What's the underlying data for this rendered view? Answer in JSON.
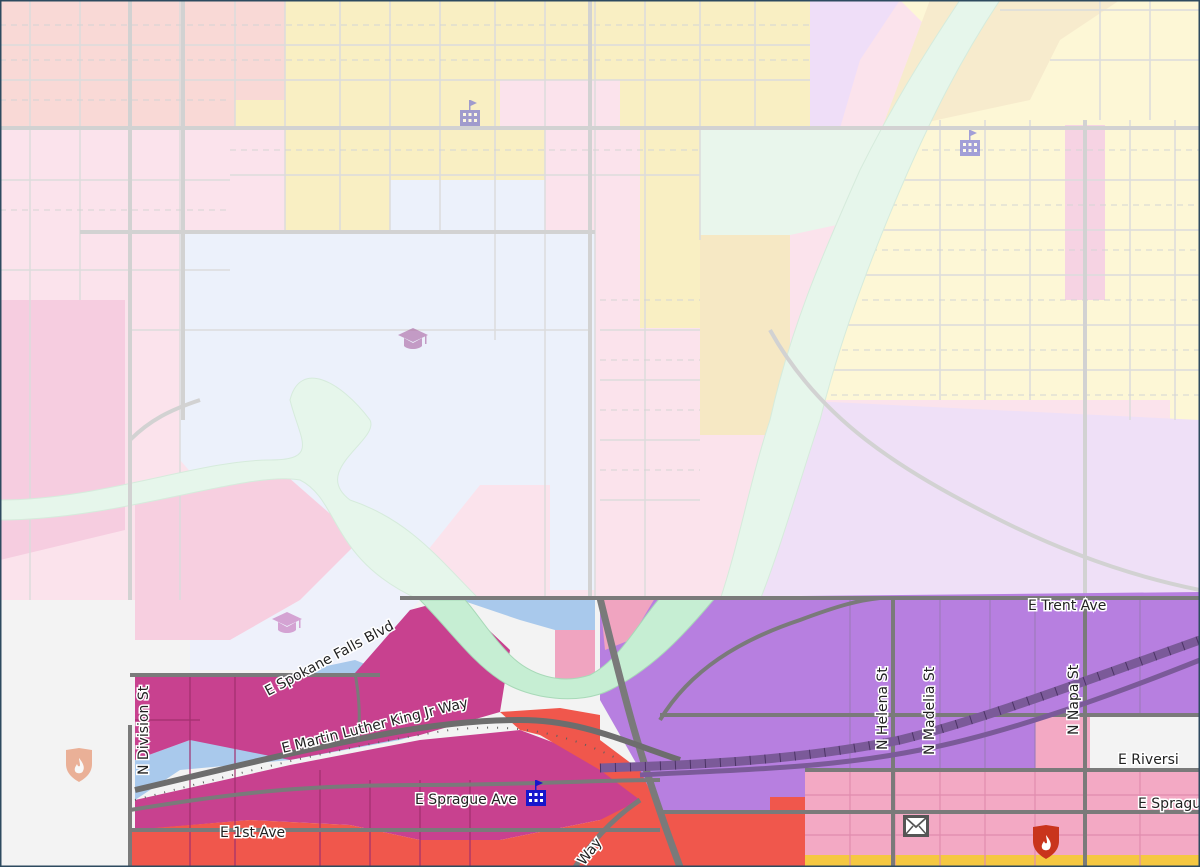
{
  "map": {
    "streets": [
      {
        "id": "e-trent-ave",
        "label": "E Trent Ave"
      },
      {
        "id": "e-spokane-falls-blvd",
        "label": "E Spokane Falls Blvd"
      },
      {
        "id": "e-mlk-jr-way",
        "label": "E Martin Luther King Jr Way"
      },
      {
        "id": "n-division-st",
        "label": "N Division St"
      },
      {
        "id": "n-helena-st",
        "label": "N Helena St"
      },
      {
        "id": "n-madelia-st",
        "label": "N Madelia St"
      },
      {
        "id": "n-napa-st",
        "label": "N Napa St"
      },
      {
        "id": "e-riverside",
        "label": "E Riversi"
      },
      {
        "id": "e-sprague-ave",
        "label": "E Sprague Ave"
      },
      {
        "id": "e-sprague-right",
        "label": "E Sprague"
      },
      {
        "id": "e-1st-ave",
        "label": "E 1st Ave"
      },
      {
        "id": "way-fragment",
        "label": "Way"
      }
    ],
    "poi_icons": [
      "hospital-icon",
      "hospital-icon",
      "hospital-icon",
      "school-icon",
      "school-icon",
      "fire-station-icon",
      "fire-station-icon",
      "post-office-icon"
    ],
    "colors": {
      "downtown_core": "#c8418f",
      "commercial_red": "#f0574c",
      "industrial_purple": "#b77fe0",
      "residential_pink": "#f3a9c4",
      "institutional_blue": "#a9c9ec",
      "river_green": "#c6eed3",
      "faded_yellow": "#f9eeb8",
      "faded_pink": "#fbe0ea",
      "faded_purple": "#efe1f8",
      "faded_blue": "#ecf1fb"
    }
  }
}
